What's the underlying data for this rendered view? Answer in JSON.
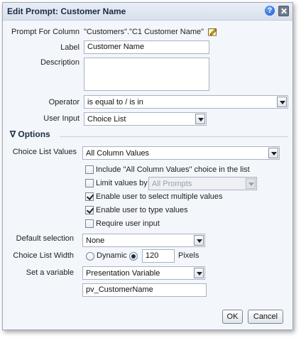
{
  "dialog": {
    "title": "Edit Prompt: Customer Name",
    "help_icon": "question-circle",
    "close_icon": "close-x"
  },
  "form": {
    "prompt_for_column_label": "Prompt For Column",
    "prompt_for_column_value": "\"Customers\".\"C1 Customer Name\"",
    "label_label": "Label",
    "label_value": "Customer Name",
    "description_label": "Description",
    "description_value": "",
    "operator_label": "Operator",
    "operator_value": "is equal to / is in",
    "user_input_label": "User Input",
    "user_input_value": "Choice List"
  },
  "options": {
    "header": "Options",
    "choice_list_values_label": "Choice List Values",
    "choice_list_values_value": "All Column Values",
    "checkboxes": [
      {
        "label": "Include \"All Column Values\" choice in the list",
        "checked": false
      },
      {
        "label": "Limit values by",
        "checked": false
      },
      {
        "label": "Enable user to select multiple values",
        "checked": true
      },
      {
        "label": "Enable user to type values",
        "checked": true
      },
      {
        "label": "Require user input",
        "checked": false
      }
    ],
    "limit_values_by_value": "All Prompts",
    "default_selection_label": "Default selection",
    "default_selection_value": "None",
    "choice_list_width_label": "Choice List Width",
    "dynamic_label": "Dynamic",
    "width_value": "120",
    "pixels_label": "Pixels",
    "set_variable_label": "Set a variable",
    "set_variable_value": "Presentation Variable",
    "variable_name_value": "pv_CustomerName"
  },
  "buttons": {
    "ok": "OK",
    "cancel": "Cancel"
  }
}
